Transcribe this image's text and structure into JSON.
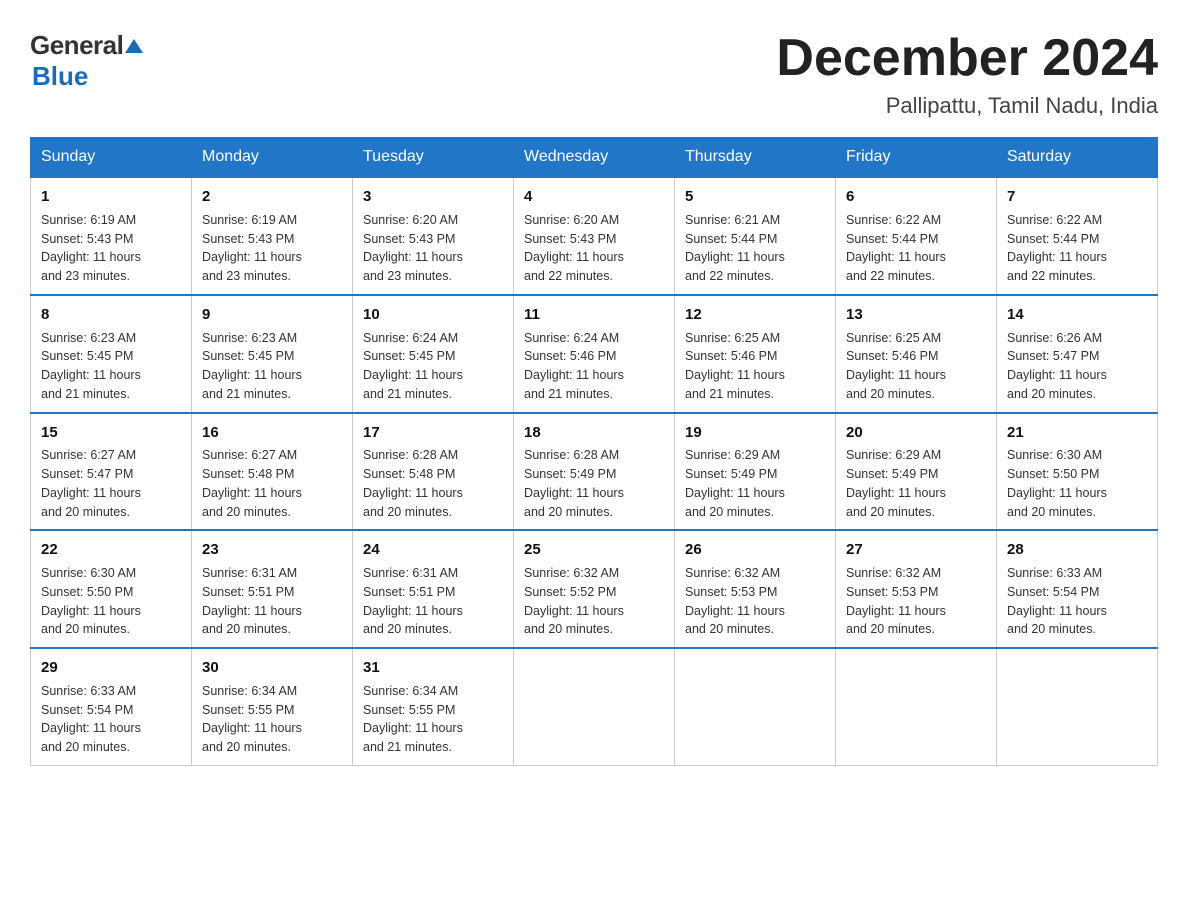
{
  "logo": {
    "general": "General",
    "blue": "Blue"
  },
  "header": {
    "month_year": "December 2024",
    "location": "Pallipattu, Tamil Nadu, India"
  },
  "weekdays": [
    "Sunday",
    "Monday",
    "Tuesday",
    "Wednesday",
    "Thursday",
    "Friday",
    "Saturday"
  ],
  "weeks": [
    [
      {
        "day": 1,
        "sunrise": "6:19 AM",
        "sunset": "5:43 PM",
        "daylight": "11 hours and 23 minutes."
      },
      {
        "day": 2,
        "sunrise": "6:19 AM",
        "sunset": "5:43 PM",
        "daylight": "11 hours and 23 minutes."
      },
      {
        "day": 3,
        "sunrise": "6:20 AM",
        "sunset": "5:43 PM",
        "daylight": "11 hours and 23 minutes."
      },
      {
        "day": 4,
        "sunrise": "6:20 AM",
        "sunset": "5:43 PM",
        "daylight": "11 hours and 22 minutes."
      },
      {
        "day": 5,
        "sunrise": "6:21 AM",
        "sunset": "5:44 PM",
        "daylight": "11 hours and 22 minutes."
      },
      {
        "day": 6,
        "sunrise": "6:22 AM",
        "sunset": "5:44 PM",
        "daylight": "11 hours and 22 minutes."
      },
      {
        "day": 7,
        "sunrise": "6:22 AM",
        "sunset": "5:44 PM",
        "daylight": "11 hours and 22 minutes."
      }
    ],
    [
      {
        "day": 8,
        "sunrise": "6:23 AM",
        "sunset": "5:45 PM",
        "daylight": "11 hours and 21 minutes."
      },
      {
        "day": 9,
        "sunrise": "6:23 AM",
        "sunset": "5:45 PM",
        "daylight": "11 hours and 21 minutes."
      },
      {
        "day": 10,
        "sunrise": "6:24 AM",
        "sunset": "5:45 PM",
        "daylight": "11 hours and 21 minutes."
      },
      {
        "day": 11,
        "sunrise": "6:24 AM",
        "sunset": "5:46 PM",
        "daylight": "11 hours and 21 minutes."
      },
      {
        "day": 12,
        "sunrise": "6:25 AM",
        "sunset": "5:46 PM",
        "daylight": "11 hours and 21 minutes."
      },
      {
        "day": 13,
        "sunrise": "6:25 AM",
        "sunset": "5:46 PM",
        "daylight": "11 hours and 20 minutes."
      },
      {
        "day": 14,
        "sunrise": "6:26 AM",
        "sunset": "5:47 PM",
        "daylight": "11 hours and 20 minutes."
      }
    ],
    [
      {
        "day": 15,
        "sunrise": "6:27 AM",
        "sunset": "5:47 PM",
        "daylight": "11 hours and 20 minutes."
      },
      {
        "day": 16,
        "sunrise": "6:27 AM",
        "sunset": "5:48 PM",
        "daylight": "11 hours and 20 minutes."
      },
      {
        "day": 17,
        "sunrise": "6:28 AM",
        "sunset": "5:48 PM",
        "daylight": "11 hours and 20 minutes."
      },
      {
        "day": 18,
        "sunrise": "6:28 AM",
        "sunset": "5:49 PM",
        "daylight": "11 hours and 20 minutes."
      },
      {
        "day": 19,
        "sunrise": "6:29 AM",
        "sunset": "5:49 PM",
        "daylight": "11 hours and 20 minutes."
      },
      {
        "day": 20,
        "sunrise": "6:29 AM",
        "sunset": "5:49 PM",
        "daylight": "11 hours and 20 minutes."
      },
      {
        "day": 21,
        "sunrise": "6:30 AM",
        "sunset": "5:50 PM",
        "daylight": "11 hours and 20 minutes."
      }
    ],
    [
      {
        "day": 22,
        "sunrise": "6:30 AM",
        "sunset": "5:50 PM",
        "daylight": "11 hours and 20 minutes."
      },
      {
        "day": 23,
        "sunrise": "6:31 AM",
        "sunset": "5:51 PM",
        "daylight": "11 hours and 20 minutes."
      },
      {
        "day": 24,
        "sunrise": "6:31 AM",
        "sunset": "5:51 PM",
        "daylight": "11 hours and 20 minutes."
      },
      {
        "day": 25,
        "sunrise": "6:32 AM",
        "sunset": "5:52 PM",
        "daylight": "11 hours and 20 minutes."
      },
      {
        "day": 26,
        "sunrise": "6:32 AM",
        "sunset": "5:53 PM",
        "daylight": "11 hours and 20 minutes."
      },
      {
        "day": 27,
        "sunrise": "6:32 AM",
        "sunset": "5:53 PM",
        "daylight": "11 hours and 20 minutes."
      },
      {
        "day": 28,
        "sunrise": "6:33 AM",
        "sunset": "5:54 PM",
        "daylight": "11 hours and 20 minutes."
      }
    ],
    [
      {
        "day": 29,
        "sunrise": "6:33 AM",
        "sunset": "5:54 PM",
        "daylight": "11 hours and 20 minutes."
      },
      {
        "day": 30,
        "sunrise": "6:34 AM",
        "sunset": "5:55 PM",
        "daylight": "11 hours and 20 minutes."
      },
      {
        "day": 31,
        "sunrise": "6:34 AM",
        "sunset": "5:55 PM",
        "daylight": "11 hours and 21 minutes."
      },
      null,
      null,
      null,
      null
    ]
  ],
  "labels": {
    "sunrise": "Sunrise:",
    "sunset": "Sunset:",
    "daylight": "Daylight:"
  }
}
